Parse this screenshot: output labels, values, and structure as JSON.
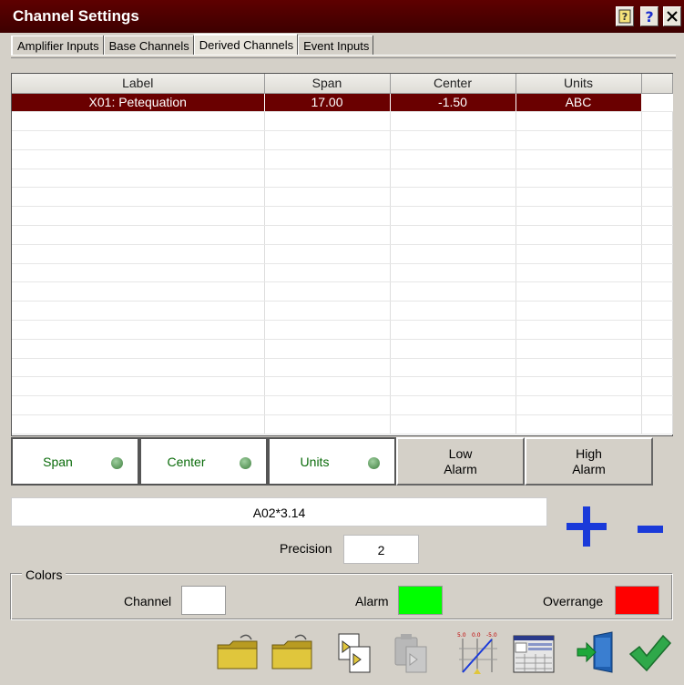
{
  "window": {
    "title": "Channel Settings"
  },
  "tabs": [
    {
      "label": "Amplifier Inputs"
    },
    {
      "label": "Base Channels"
    },
    {
      "label": "Derived Channels"
    },
    {
      "label": "Event Inputs"
    }
  ],
  "grid": {
    "columns": [
      "Label",
      "Span",
      "Center",
      "Units"
    ],
    "rows": [
      [
        "X01: Petequation",
        "17.00",
        "-1.50",
        "ABC"
      ]
    ]
  },
  "column_buttons": [
    {
      "label": "Span"
    },
    {
      "label": "Center"
    },
    {
      "label": "Units"
    },
    {
      "line1": "Low",
      "line2": "Alarm"
    },
    {
      "line1": "High",
      "line2": "Alarm"
    }
  ],
  "formula": {
    "value": "A02*3.14"
  },
  "precision": {
    "label": "Precision",
    "value": "2"
  },
  "colors": {
    "title": "Colors",
    "channel_label": "Channel",
    "alarm_label": "Alarm",
    "overrange_label": "Overrange",
    "channel_color": "#ffffff",
    "alarm_color": "#00ff00",
    "overrange_color": "#ff0000"
  },
  "accent": {
    "title_bar": "#4a0000",
    "selected_row": "#6a0000",
    "plus_minus": "#1a3ad9"
  },
  "icons": [
    "help-icon",
    "context-help-icon",
    "close-icon",
    "open-folder-icon",
    "save-folder-icon",
    "copy-icon",
    "paste-icon",
    "scale-icon",
    "table-icon",
    "exit-icon",
    "ok-check-icon"
  ]
}
